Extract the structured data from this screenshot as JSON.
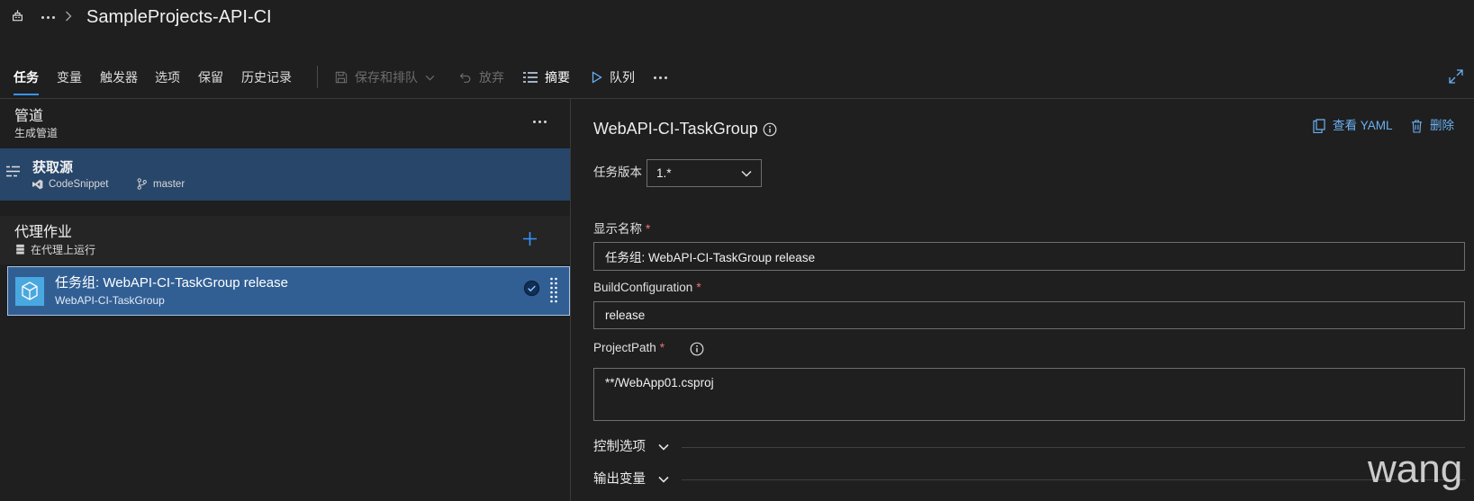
{
  "header": {
    "title": "SampleProjects-API-CI",
    "icon": "pipeline-icon"
  },
  "toolbar": {
    "tabs": [
      {
        "label": "任务",
        "active": true
      },
      {
        "label": "变量",
        "active": false
      },
      {
        "label": "触发器",
        "active": false
      },
      {
        "label": "选项",
        "active": false
      },
      {
        "label": "保留",
        "active": false
      },
      {
        "label": "历史记录",
        "active": false
      }
    ],
    "save_queue": {
      "label": "保存和排队",
      "enabled": false,
      "icon": "save-icon"
    },
    "discard": {
      "label": "放弃",
      "enabled": false,
      "icon": "undo-icon"
    },
    "summary": {
      "label": "摘要",
      "enabled": true,
      "icon": "list-icon"
    },
    "queue": {
      "label": "队列",
      "enabled": true,
      "icon": "play-icon"
    }
  },
  "pipeline_panel": {
    "header": {
      "title": "管道",
      "subtitle": "生成管道"
    },
    "get_sources": {
      "title": "获取源",
      "repository": "CodeSnippet",
      "branch": "master"
    },
    "agent_job": {
      "title": "代理作业",
      "subtitle": "在代理上运行"
    },
    "tasks": [
      {
        "title": "任务组: WebAPI-CI-TaskGroup release",
        "subtitle": "WebAPI-CI-TaskGroup",
        "selected": true,
        "enabled": true
      }
    ]
  },
  "task_details": {
    "title": "WebAPI-CI-TaskGroup",
    "view_yaml": "查看 YAML",
    "remove": "删除",
    "version": {
      "label": "任务版本",
      "value": "1.*"
    },
    "fields": [
      {
        "label": "显示名称",
        "required_mark": "*",
        "value": "任务组: WebAPI-CI-TaskGroup release"
      },
      {
        "label": "BuildConfiguration",
        "required_mark": "*",
        "value": "release"
      },
      {
        "label": "ProjectPath",
        "required_mark": "*",
        "value": "**/WebApp01.csproj"
      }
    ],
    "sections": [
      {
        "label": "控制选项",
        "expanded": false
      },
      {
        "label": "输出变量",
        "expanded": false
      }
    ]
  },
  "watermark": "wang",
  "colors": {
    "background": "#1f1f1f",
    "text": "#e6e6e6",
    "accent": "#3794ff",
    "link": "#6ab0f3",
    "required": "#f1707b",
    "disabled": "#6d6d6d",
    "source_row_bg": "#27466a",
    "task_row_bg": "#315f94",
    "task_icon_bg": "#4aa8e0",
    "agent_bg": "#252525"
  }
}
